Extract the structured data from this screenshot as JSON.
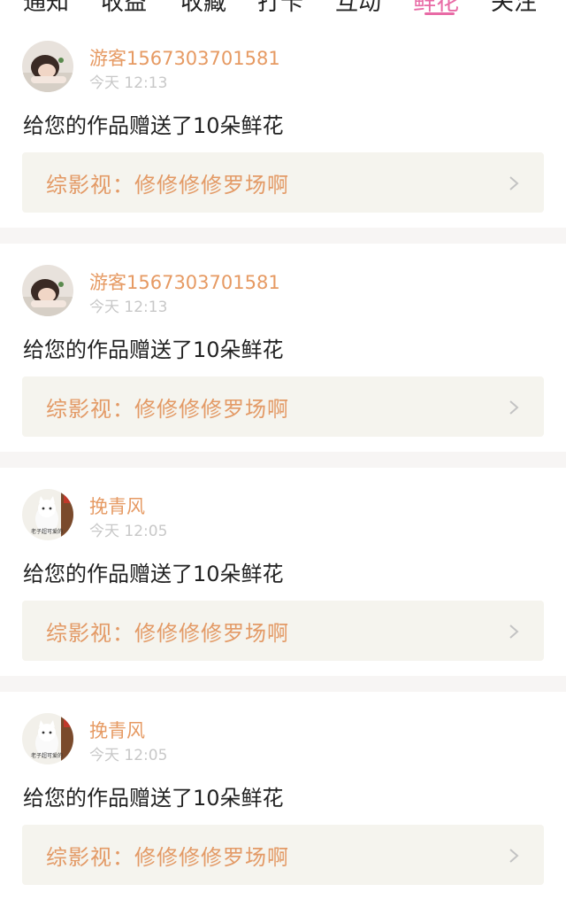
{
  "tabs": [
    {
      "label": "通知"
    },
    {
      "label": "收益"
    },
    {
      "label": "收藏"
    },
    {
      "label": "打卡"
    },
    {
      "label": "互动"
    },
    {
      "label": "鲜花",
      "active": true
    },
    {
      "label": "关注"
    }
  ],
  "notifications": [
    {
      "username": "游客1567303701581",
      "time": "今天 12:13",
      "message": "给您的作品赠送了10朵鲜花",
      "work_title": "综影视：修修修修罗场啊",
      "avatar": "girl-photo"
    },
    {
      "username": "游客1567303701581",
      "time": "今天 12:13",
      "message": "给您的作品赠送了10朵鲜花",
      "work_title": "综影视：修修修修罗场啊",
      "avatar": "girl-photo"
    },
    {
      "username": "挽青风",
      "time": "今天 12:05",
      "message": "给您的作品赠送了10朵鲜花",
      "work_title": "综影视：修修修修罗场啊",
      "avatar": "cat-photo",
      "avatar_caption": "老子超可爱的"
    },
    {
      "username": "挽青风",
      "time": "今天 12:05",
      "message": "给您的作品赠送了10朵鲜花",
      "work_title": "综影视：修修修修罗场啊",
      "avatar": "cat-photo",
      "avatar_caption": "老子超可爱的"
    }
  ],
  "colors": {
    "accent_pink": "#e86aa5",
    "username_orange": "#e69a63",
    "link_bg": "#f5f4ee",
    "divider_bg": "#f7f5f4"
  },
  "icons": {
    "chevron": "chevron-right-icon"
  }
}
